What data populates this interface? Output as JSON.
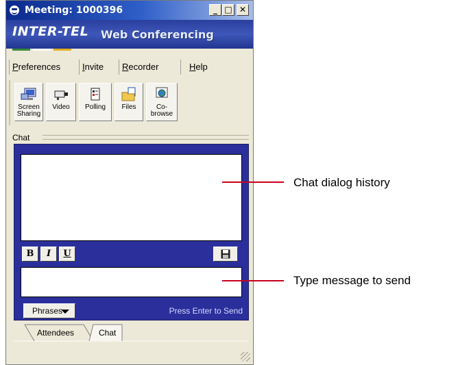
{
  "window": {
    "title": "Meeting: 1000396"
  },
  "title_buttons": {
    "minimize": "_",
    "maximize": "□",
    "close": "✕"
  },
  "banner": {
    "logo_text": "INTER-TEL",
    "subtitle": "Web Conferencing"
  },
  "menu": {
    "items": [
      {
        "label": "Preferences",
        "mnemonic": "P"
      },
      {
        "label": "Invite",
        "mnemonic": "I"
      },
      {
        "label": "Recorder",
        "mnemonic": "R"
      },
      {
        "label": "Help",
        "mnemonic": "H"
      }
    ]
  },
  "toolbar": {
    "items": [
      {
        "label_line1": "Screen",
        "label_line2": "Sharing",
        "icon": "screen-sharing-icon"
      },
      {
        "label_line1": "Video",
        "label_line2": "",
        "icon": "video-camera-icon"
      },
      {
        "label_line1": "Polling",
        "label_line2": "",
        "icon": "polling-icon"
      },
      {
        "label_line1": "Files",
        "label_line2": "",
        "icon": "files-icon"
      },
      {
        "label_line1": "Co-",
        "label_line2": "browse",
        "icon": "co-browse-icon"
      }
    ]
  },
  "chat": {
    "section_label": "Chat",
    "history_text": "",
    "compose_text": "",
    "format": {
      "bold": "B",
      "italic": "I",
      "underline": "U"
    },
    "phrases_label": "Phrases",
    "send_hint": "Press Enter to Send"
  },
  "tabs": {
    "attendees": "Attendees",
    "chat": "Chat",
    "active": "Chat"
  },
  "callouts": {
    "history": "Chat dialog history",
    "compose": "Type message to send"
  },
  "colors": {
    "accent": "#2b2f9c",
    "callout_line": "#c8001e",
    "titlebar": "#0b2a8c"
  }
}
